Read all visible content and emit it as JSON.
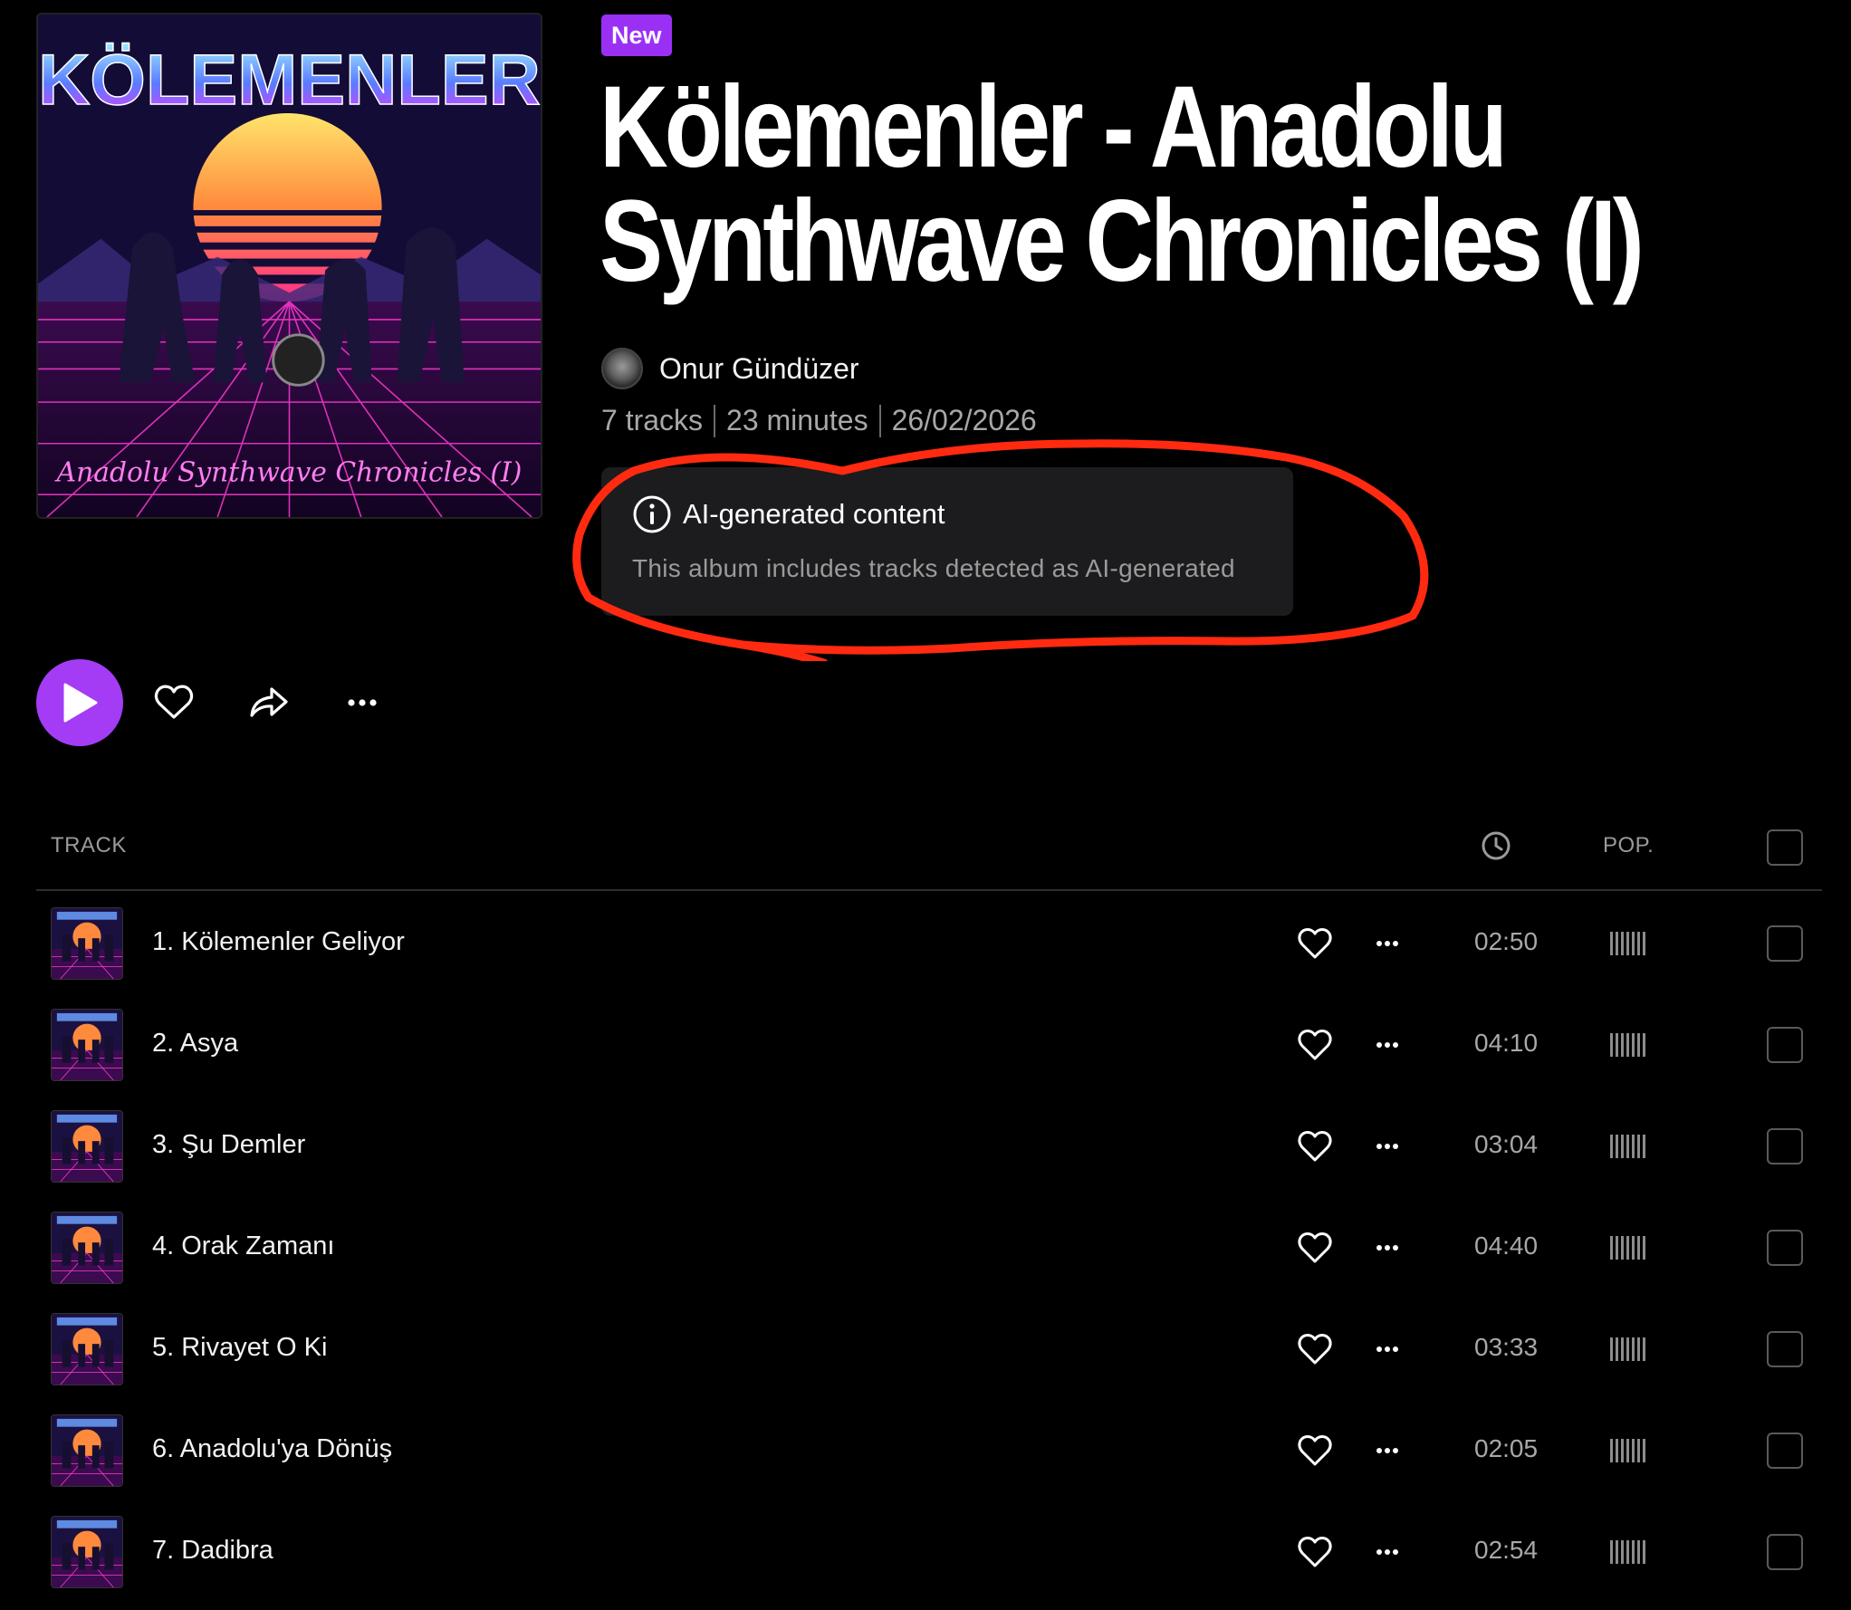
{
  "album": {
    "badge": "New",
    "title_line1": "Kölemenler - Anadolu",
    "title_line2": "Synthwave Chronicles (I)",
    "cover_title": "KÖLEMENLER",
    "cover_subtitle": "Anadolu Synthwave Chronicles (I)",
    "artist": "Onur Gündüzer",
    "tracks_count": "7 tracks",
    "duration": "23 minutes",
    "date": "26/02/2026"
  },
  "ai_notice": {
    "title": "AI-generated content",
    "description": "This album includes tracks detected as AI-generated"
  },
  "table": {
    "header_track": "TRACK",
    "header_pop": "POP."
  },
  "tracks": [
    {
      "title": "1. Kölemenler Geliyor",
      "duration": "02:50"
    },
    {
      "title": "2. Asya",
      "duration": "04:10"
    },
    {
      "title": "3. Şu Demler",
      "duration": "03:04"
    },
    {
      "title": "4. Orak Zamanı",
      "duration": "04:40"
    },
    {
      "title": "5. Rivayet O Ki",
      "duration": "03:33"
    },
    {
      "title": "6. Anadolu'ya Dönüş",
      "duration": "02:05"
    },
    {
      "title": "7. Dadibra",
      "duration": "02:54"
    }
  ],
  "colors": {
    "accent": "#a43cf5",
    "badge": "#9b30f5",
    "annotation": "#ff2a10",
    "background": "#000000"
  },
  "icons": [
    "play-icon",
    "heart-icon",
    "share-icon",
    "more-icon",
    "info-icon",
    "clock-icon",
    "popularity-icon",
    "checkbox"
  ]
}
